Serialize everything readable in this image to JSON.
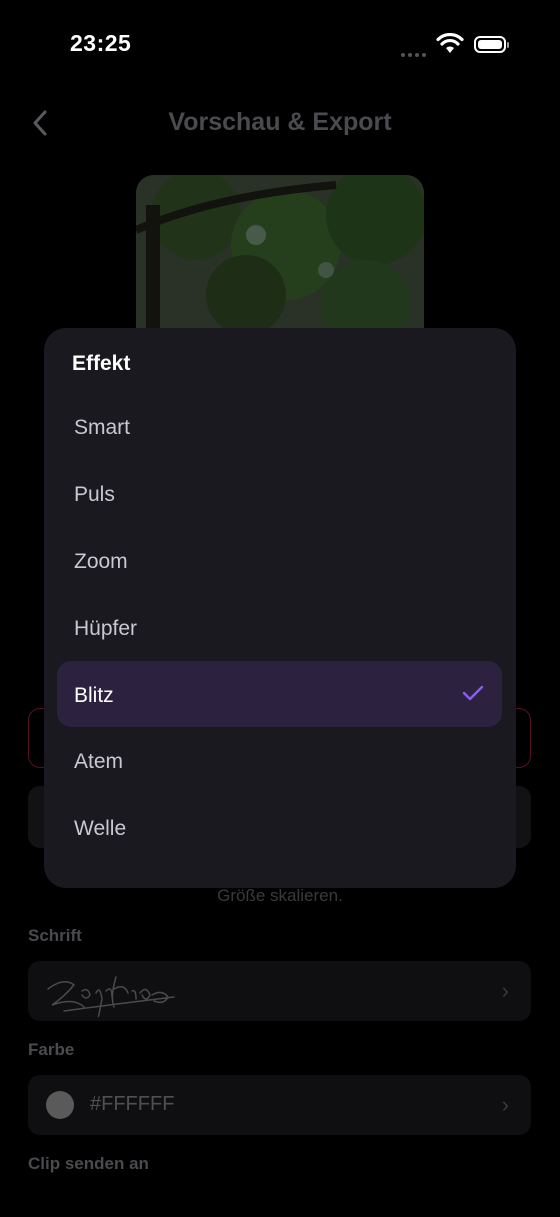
{
  "status_bar": {
    "time": "23:25"
  },
  "header": {
    "title": "Vorschau & Export"
  },
  "hint_text": "Größe skalieren.",
  "font_section": {
    "label": "Schrift",
    "value": "Zapfino"
  },
  "color_section": {
    "label": "Farbe",
    "value": "#FFFFFF"
  },
  "send_section": {
    "label": "Clip senden an"
  },
  "menu": {
    "title": "Effekt",
    "items": [
      "Smart",
      "Puls",
      "Zoom",
      "Hüpfer",
      "Blitz",
      "Atem",
      "Welle"
    ],
    "selected": "Blitz"
  },
  "colors": {
    "accent": "#8B5CF6",
    "selected_bg": "#2D2140",
    "menu_bg": "#19191F"
  }
}
